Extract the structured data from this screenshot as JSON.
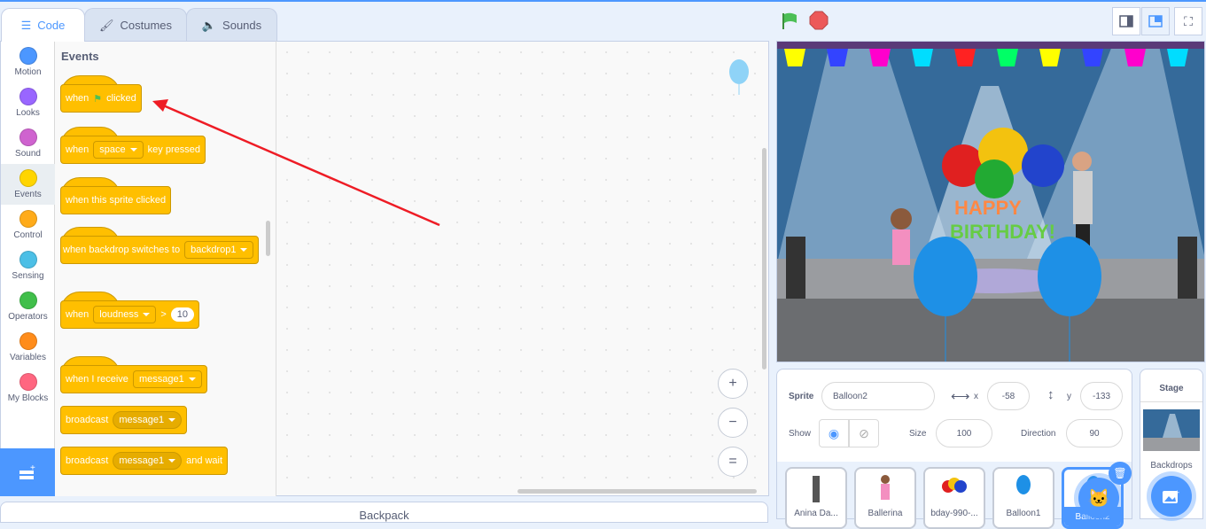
{
  "tabs": [
    {
      "label": "Code",
      "icon": "code-icon",
      "selected": true
    },
    {
      "label": "Costumes",
      "icon": "brush-icon"
    },
    {
      "label": "Sounds",
      "icon": "speaker-icon"
    }
  ],
  "categories": [
    {
      "label": "Motion",
      "color": "#4c97ff"
    },
    {
      "label": "Looks",
      "color": "#9966ff"
    },
    {
      "label": "Sound",
      "color": "#cf63cf"
    },
    {
      "label": "Events",
      "color": "#ffd500",
      "selected": true
    },
    {
      "label": "Control",
      "color": "#ffab19"
    },
    {
      "label": "Sensing",
      "color": "#4cbfe6"
    },
    {
      "label": "Operators",
      "color": "#40bf4a"
    },
    {
      "label": "Variables",
      "color": "#ff8c1a"
    },
    {
      "label": "My Blocks",
      "color": "#ff6680"
    }
  ],
  "palette": {
    "title": "Events",
    "b1": {
      "when": "when",
      "clicked": "clicked"
    },
    "b2": {
      "when": "when",
      "key": "space",
      "rest": "key pressed"
    },
    "b3": {
      "text": "when this sprite clicked"
    },
    "b4": {
      "text": "when backdrop switches to",
      "value": "backdrop1"
    },
    "b5": {
      "when": "when",
      "sel": "loudness",
      "op": ">",
      "value": "10"
    },
    "b6": {
      "text": "when I receive",
      "value": "message1"
    },
    "b7": {
      "text": "broadcast",
      "value": "message1"
    },
    "b8": {
      "text": "broadcast",
      "value": "message1",
      "rest": "and wait"
    }
  },
  "backpack": "Backpack",
  "zoom": {
    "in": "+",
    "out": "−",
    "reset": "="
  },
  "sprite_info": {
    "sprite_label": "Sprite",
    "sprite_name": "Balloon2",
    "x_label": "x",
    "x": "-58",
    "y_label": "y",
    "y": "-133",
    "show_label": "Show",
    "visible": true,
    "size_label": "Size",
    "size": "100",
    "direction_label": "Direction",
    "direction": "90"
  },
  "sprites": [
    {
      "name": "Anina Da..."
    },
    {
      "name": "Ballerina"
    },
    {
      "name": "bday-990-..."
    },
    {
      "name": "Balloon1"
    },
    {
      "name": "Balloon2",
      "selected": true
    }
  ],
  "stage_panel": {
    "title": "Stage",
    "backdrops_label": "Backdrops"
  },
  "accent": "#4c97ff",
  "annotation_arrow_color": "#ee1c25"
}
